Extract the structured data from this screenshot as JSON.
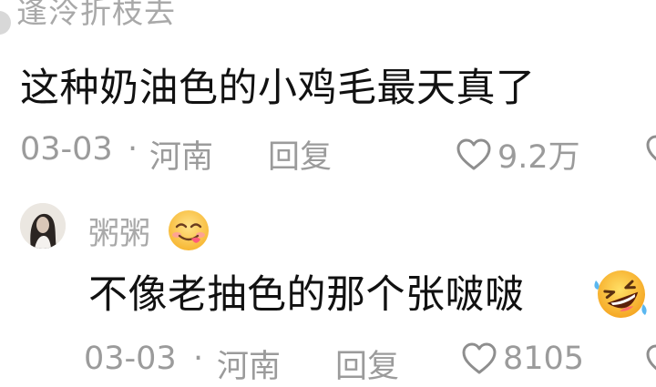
{
  "comments": [
    {
      "username": "逢泠折枝去",
      "text": "这种奶油色的小鸡毛最天真了",
      "date": "03-03",
      "separator": "·",
      "location": "河南",
      "reply_label": "回复",
      "like_count": "9.2万",
      "like_icon": "heart-outline-icon"
    },
    {
      "username": "粥粥",
      "username_emoji": "yum-face-emoji",
      "text": "不像老抽色的那个张啵啵",
      "text_emoji": "rofl-face-emoji",
      "date": "03-03",
      "separator": "·",
      "location": "河南",
      "reply_label": "回复",
      "like_count": "8105",
      "like_icon": "heart-outline-icon"
    }
  ],
  "colors": {
    "text": "#111111",
    "meta": "#9b9b9b",
    "username": "#a9a9a9",
    "background": "#ffffff"
  }
}
